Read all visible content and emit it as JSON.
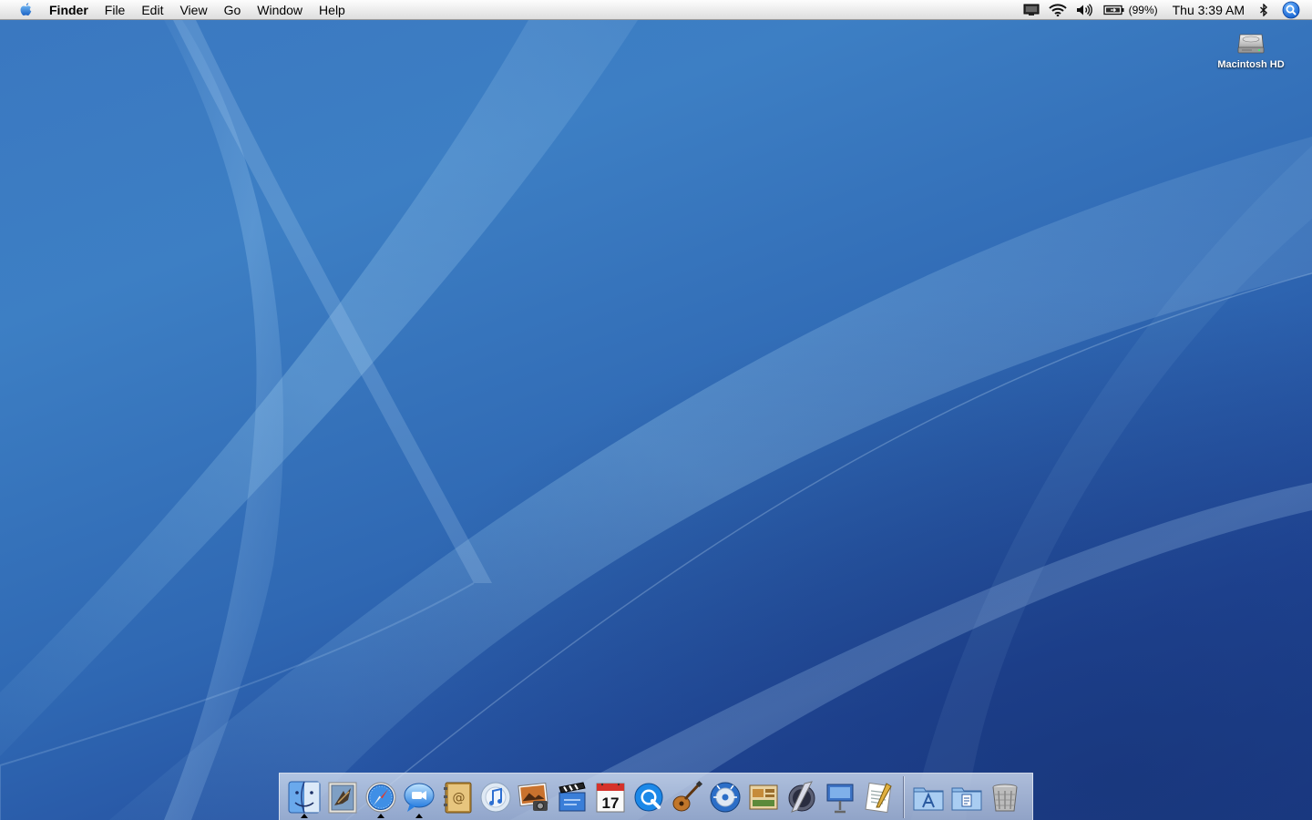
{
  "menubar": {
    "apple_icon": "apple-icon",
    "app_name": "Finder",
    "menus": [
      "File",
      "Edit",
      "View",
      "Go",
      "Window",
      "Help"
    ],
    "status": {
      "display_icon": "display-mirroring-icon",
      "wifi_icon": "wifi-icon",
      "volume_icon": "volume-icon",
      "battery_icon": "battery-icon",
      "battery_percent": "(99%)",
      "clock": "Thu 3:39 AM",
      "bluetooth_icon": "bluetooth-icon",
      "spotlight_icon": "spotlight-icon"
    }
  },
  "desktop": {
    "icons": [
      {
        "label": "Macintosh HD",
        "icon": "hard-drive-icon"
      }
    ]
  },
  "dock": {
    "apps": [
      {
        "name": "Finder",
        "icon": "finder-icon",
        "running": true
      },
      {
        "name": "Mail",
        "icon": "mail-icon",
        "running": false
      },
      {
        "name": "Safari",
        "icon": "safari-icon",
        "running": true
      },
      {
        "name": "iChat",
        "icon": "ichat-icon",
        "running": true
      },
      {
        "name": "Address Book",
        "icon": "address-book-icon",
        "running": false
      },
      {
        "name": "iTunes",
        "icon": "itunes-icon",
        "running": false
      },
      {
        "name": "iPhoto",
        "icon": "iphoto-icon",
        "running": false
      },
      {
        "name": "iMovie",
        "icon": "imovie-icon",
        "running": false
      },
      {
        "name": "iCal",
        "icon": "ical-icon",
        "running": false
      },
      {
        "name": "QuickTime Player",
        "icon": "quicktime-icon",
        "running": false
      },
      {
        "name": "GarageBand",
        "icon": "garageband-icon",
        "running": false
      },
      {
        "name": "iDVD",
        "icon": "idvd-icon",
        "running": false
      },
      {
        "name": "iWeb",
        "icon": "iweb-icon",
        "running": false
      },
      {
        "name": "Aperture",
        "icon": "aperture-icon",
        "running": false
      },
      {
        "name": "Keynote",
        "icon": "keynote-icon",
        "running": false
      },
      {
        "name": "Pages",
        "icon": "pages-icon",
        "running": false
      }
    ],
    "ical_date": "17",
    "stacks": [
      {
        "name": "Applications",
        "icon": "applications-folder-icon"
      },
      {
        "name": "Documents",
        "icon": "documents-folder-icon"
      },
      {
        "name": "Trash",
        "icon": "trash-icon"
      }
    ]
  },
  "colors": {
    "wallpaper_top": "#3d7fc4",
    "wallpaper_bottom": "#1c3d8a",
    "menubar": "#ececec"
  }
}
